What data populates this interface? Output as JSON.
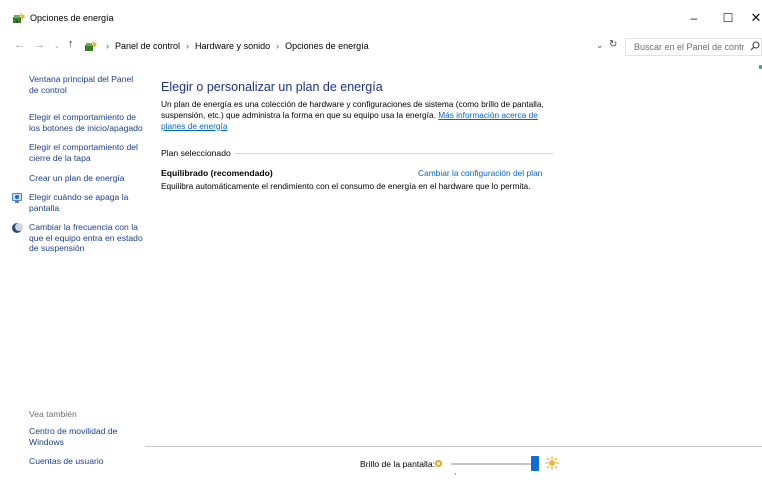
{
  "window": {
    "title": "Opciones de energía",
    "min_glyph": "–",
    "max_glyph": "☐",
    "close_glyph": "✕"
  },
  "address": {
    "breadcrumbs": [
      "Panel de control",
      "Hardware y sonido",
      "Opciones de energía"
    ],
    "search_placeholder": "Buscar en el Panel de control"
  },
  "sidebar": {
    "home_link": "Ventana principal del Panel de control",
    "links": [
      {
        "label": "Elegir el comportamiento de los botones de inicio/apagado",
        "icon": null
      },
      {
        "label": "Elegir el comportamiento del cierre de la tapa",
        "icon": null
      },
      {
        "label": "Crear un plan de energía",
        "icon": null
      },
      {
        "label": "Elegir cuándo se apaga la pantalla",
        "icon": "monitor-icon"
      },
      {
        "label": "Cambiar la frecuencia con la que el equipo entra en estado de suspensión",
        "icon": "moon-icon"
      }
    ],
    "see_also_label": "Vea también",
    "see_also_links": [
      "Centro de movilidad de Windows",
      "Cuentas de usuario"
    ]
  },
  "main": {
    "heading": "Elegir o personalizar un plan de energía",
    "description": "Un plan de energía es una colección de hardware y configuraciones de sistema (como brillo de pantalla, suspensión, etc.) que administra la forma en que su equipo usa la energía.",
    "more_info_link": "Más información acerca de planes de energía",
    "section_label": "Plan seleccionado",
    "plan": {
      "name": "Equilibrado (recomendado)",
      "change_link": "Cambiar la configuración del plan",
      "description": "Equilibra automáticamente el rendimiento con el consumo de energía en el hardware que lo permita."
    }
  },
  "brightness": {
    "label": "Brillo de la pantalla:",
    "level_percent": 100
  },
  "colors": {
    "link": "#1a3f8a",
    "heading": "#1e3287",
    "accent": "#0a6fd6"
  }
}
